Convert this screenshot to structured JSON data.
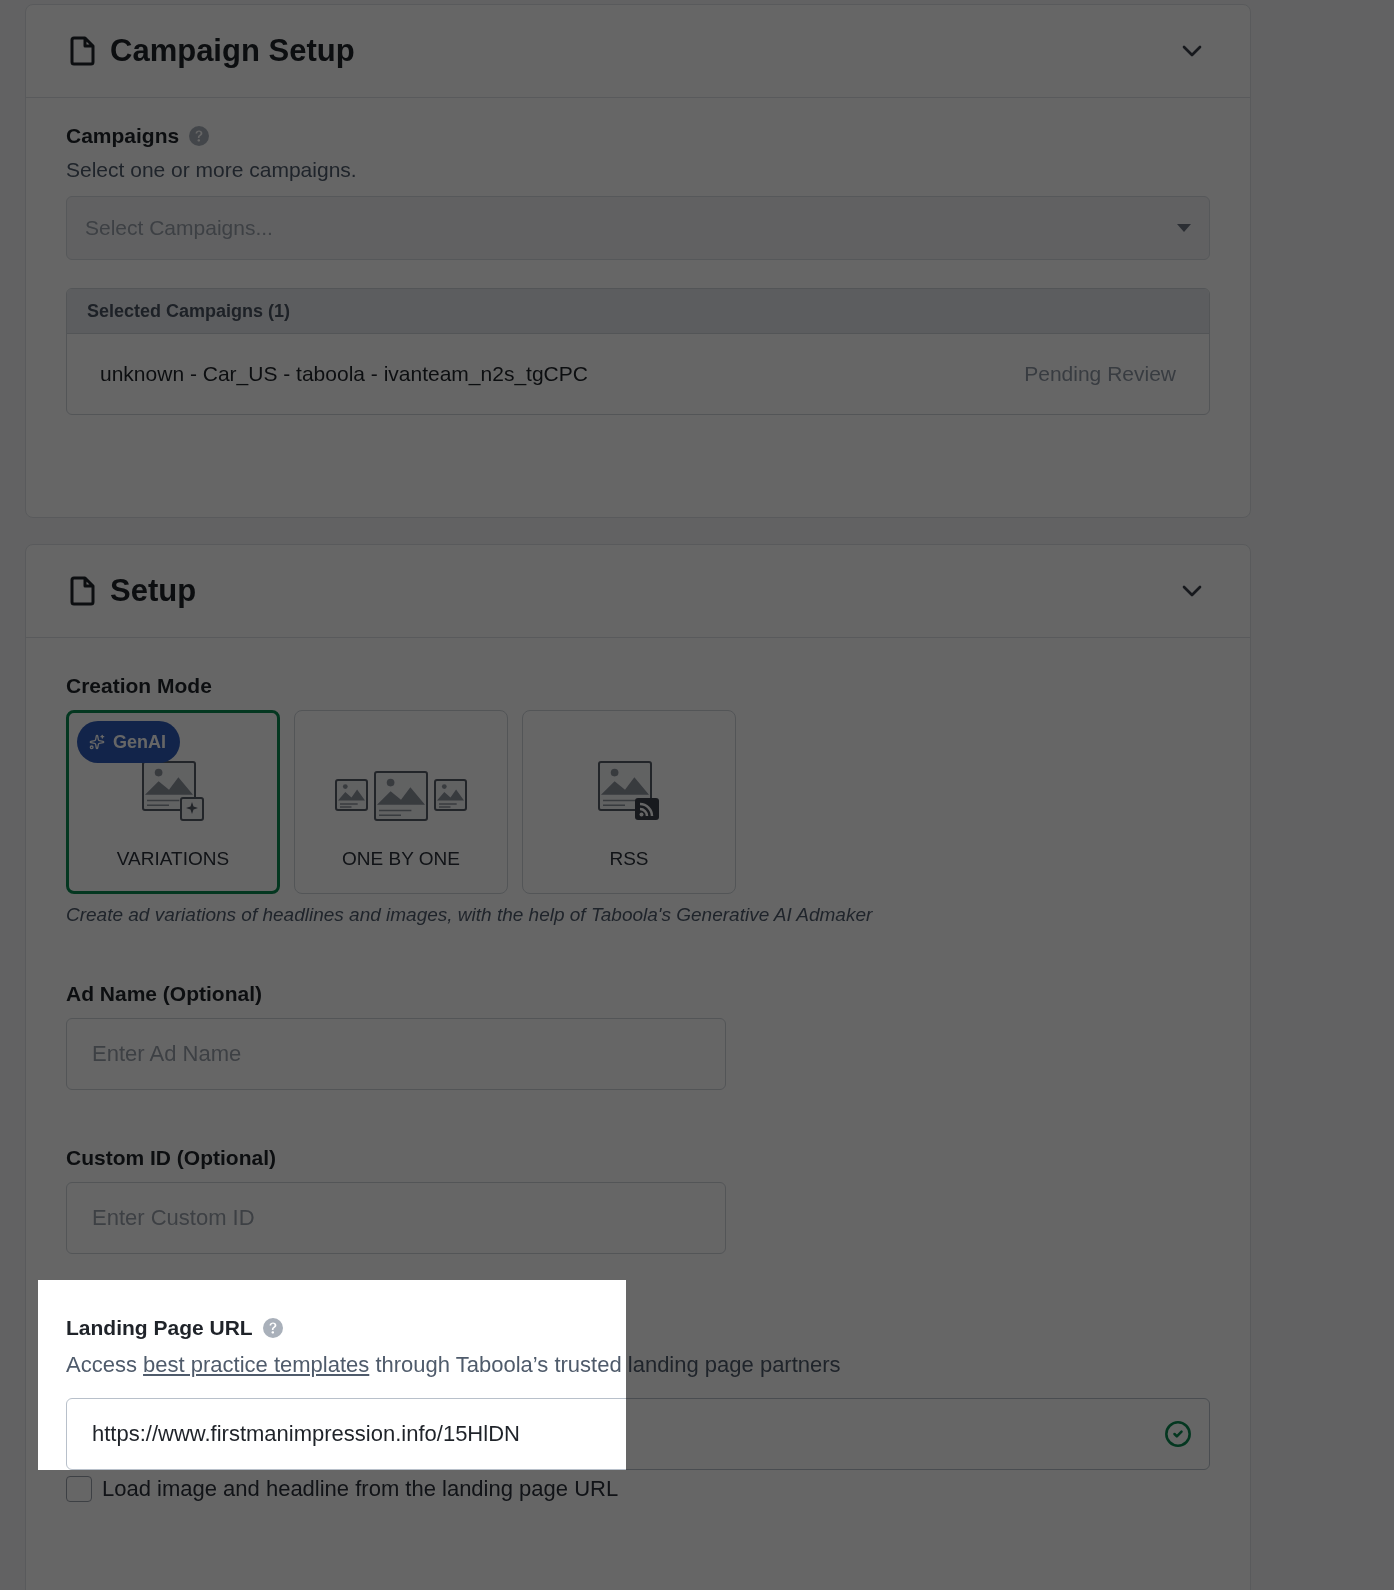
{
  "campaign_setup": {
    "title": "Campaign Setup",
    "campaigns_label": "Campaigns",
    "campaigns_description": "Select one or more campaigns.",
    "select_placeholder": "Select Campaigns...",
    "selected_header": "Selected Campaigns (1)",
    "selected": [
      {
        "name": "unknown - Car_US - taboola - ivanteam_n2s_tgCPC",
        "status": "Pending Review"
      }
    ]
  },
  "setup": {
    "title": "Setup",
    "creation_mode_label": "Creation Mode",
    "modes": [
      {
        "kind": "variations",
        "label": "VARIATIONS",
        "badge": "GenAI",
        "selected": true
      },
      {
        "kind": "one_by_one",
        "label": "ONE BY ONE",
        "selected": false
      },
      {
        "kind": "rss",
        "label": "RSS",
        "selected": false
      }
    ],
    "mode_description": "Create ad variations of headlines and images, with the help of Taboola's Generative AI Admaker",
    "ad_name": {
      "label": "Ad Name (Optional)",
      "placeholder": "Enter Ad Name"
    },
    "custom_id": {
      "label": "Custom ID (Optional)",
      "placeholder": "Enter Custom ID"
    },
    "landing_page": {
      "label": "Landing Page URL",
      "description_before": "Access",
      "link": "best practice templates",
      "description_after": "through Taboola’s trusted landing page partners",
      "value": "https://www.firstmanimpression.info/15HlDN",
      "valid": true,
      "load_checkbox": {
        "label": "Load image and headline from the landing page URL",
        "checked": false
      }
    }
  }
}
